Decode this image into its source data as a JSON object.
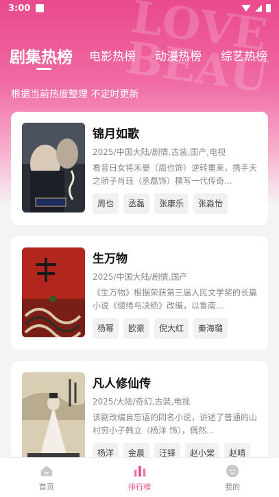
{
  "status": {
    "time": "3:00"
  },
  "tabs": [
    {
      "label": "剧集热榜",
      "active": true
    },
    {
      "label": "电影热榜"
    },
    {
      "label": "动漫热榜"
    },
    {
      "label": "综艺热榜"
    }
  ],
  "subtitle": "根据当前热度整理 不定时更新",
  "cards": [
    {
      "title": "锦月如歌",
      "meta": "2025/中国大陆/剧情,古装,国产,电视",
      "desc": "看昔日女将禾晏（周也饰）逆转重来，携手天之骄子肖珏（丞磊饰）撰写一代传奇…",
      "tags": [
        "周也",
        "丞磊",
        "张康乐",
        "张淼怡"
      ],
      "poster_colors": [
        "#2a2f3a",
        "#6b6f7a",
        "#c7c2b6"
      ]
    },
    {
      "title": "生万物",
      "meta": "2025/中国大陆/剧情,国产",
      "desc": "《生万物》根据荣获第三届人民文学奖的长篇小说《缱绻与决绝》改编，以鲁南…",
      "tags": [
        "杨幂",
        "欧豪",
        "倪大红",
        "秦海璐"
      ],
      "poster_colors": [
        "#b3261e",
        "#8a1c16",
        "#3a2a22"
      ]
    },
    {
      "title": "凡人修仙传",
      "meta": "2025/大陆/奇幻,古装,电视",
      "desc": "该剧改编自忘语的同名小说，讲述了普通的山村穷小子韩立（杨洋 饰），偶然…",
      "tags": [
        "杨洋",
        "金晨",
        "汪铎",
        "赵小棠",
        "赵晴"
      ],
      "poster_colors": [
        "#d9cdb4",
        "#a89b82",
        "#5b5447"
      ]
    }
  ],
  "nav": [
    {
      "label": "首页",
      "icon": "home-icon"
    },
    {
      "label": "排行榜",
      "icon": "chart-icon",
      "active": true
    },
    {
      "label": "我的",
      "icon": "profile-icon"
    }
  ],
  "colors": {
    "accent": "#e94a8d"
  }
}
